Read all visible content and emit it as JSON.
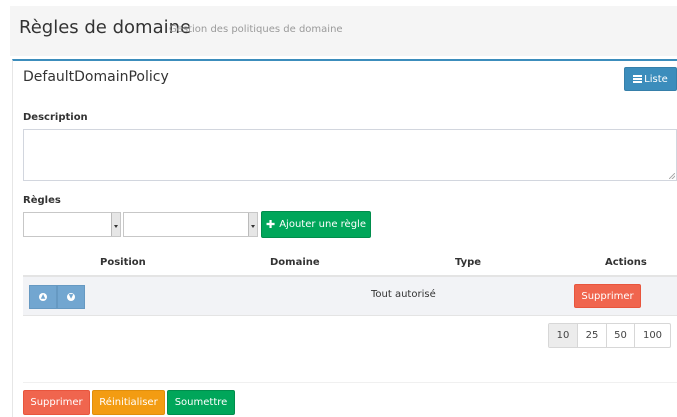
{
  "header": {
    "title": "Règles de domaine",
    "subtitle": "Gestion des politiques de domaine"
  },
  "panel": {
    "title": "DefaultDomainPolicy",
    "list_button": {
      "label": "Liste",
      "icon": "list-icon"
    }
  },
  "form": {
    "description_label": "Description",
    "description_value": "",
    "rules_label": "Règles",
    "select_first_value": "",
    "select_second_value": "",
    "add_rule_button": "Ajouter une règle"
  },
  "table": {
    "headers": [
      "Position",
      "Domaine",
      "Type",
      "Actions"
    ],
    "rows": [
      {
        "up_icon": "arrow-circle-up-icon",
        "down_icon": "arrow-circle-down-icon",
        "domaine": "",
        "type": "Tout autorisé",
        "delete_label": "Supprimer"
      }
    ],
    "page_sizes": [
      "10",
      "25",
      "50",
      "100"
    ],
    "selected_page_size": "10"
  },
  "footer": {
    "delete_label": "Supprimer",
    "reset_label": "Réinitialiser",
    "submit_label": "Soumettre"
  },
  "colors": {
    "primary": "#3c8dbc",
    "success": "#00a65a",
    "danger": "#f0654e",
    "warning": "#f39c12",
    "info": "#72a6d0"
  }
}
